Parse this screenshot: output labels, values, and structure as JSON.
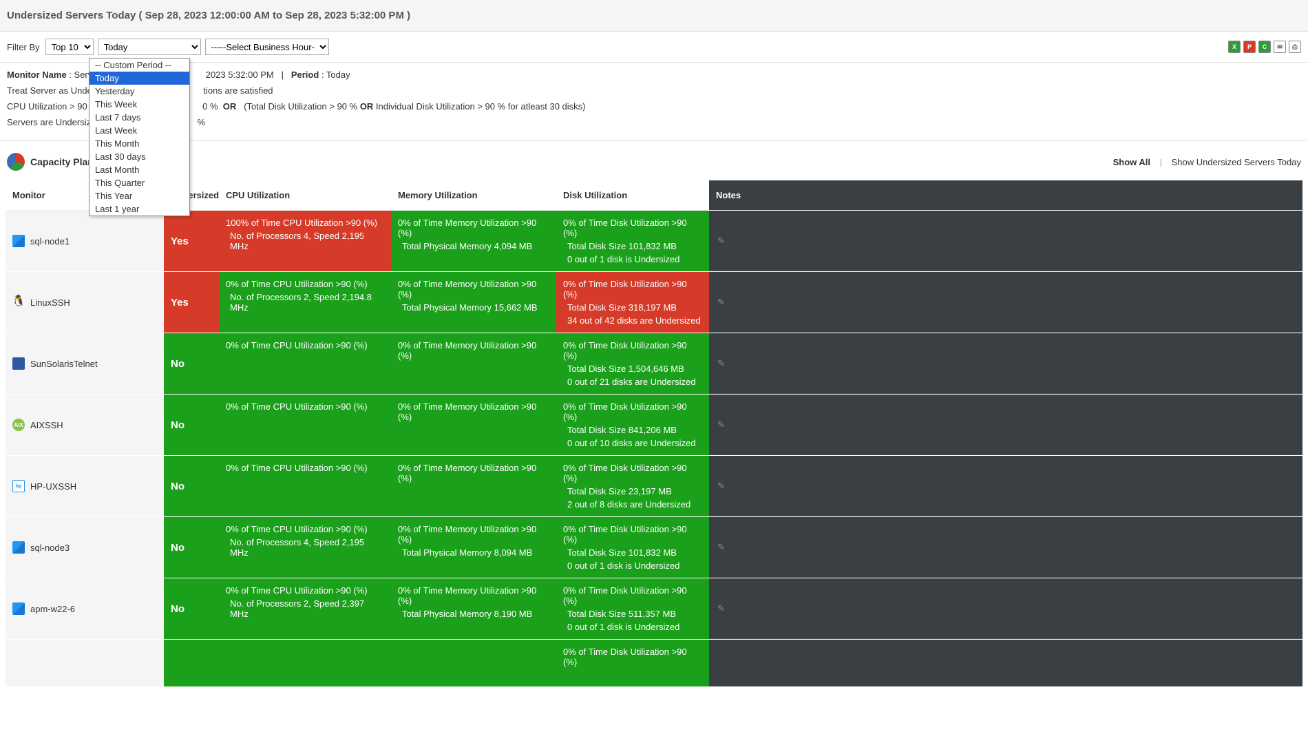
{
  "title": "Undersized Servers Today ( Sep 28, 2023 12:00:00 AM to Sep 28, 2023 5:32:00 PM )",
  "filter": {
    "label": "Filter By",
    "topn": "Top 10",
    "period": "Today",
    "biz_hour": "-----Select Business Hour---"
  },
  "dropdown": {
    "items": [
      "-- Custom Period --",
      "Today",
      "Yesterday",
      "This Week",
      "Last 7 days",
      "Last Week",
      "This Month",
      "Last 30 days",
      "Last Month",
      "This Quarter",
      "This Year",
      "Last 1 year"
    ],
    "selected": "Today"
  },
  "info": {
    "monitor_name_label": "Monitor Name",
    "monitor_name_value": ": Serve",
    "time_suffix": "2023 5:32:00 PM",
    "sep": "|",
    "period_label": "Period",
    "period_value": ": Today",
    "line2_a": "Treat Server as Under",
    "line2_b": "tions are satisfied",
    "line3_a": "CPU Utilization > 90 %",
    "line3_b": "0 %",
    "line3_or": "OR",
    "line3_c": "(Total Disk Utilization > 90 % ",
    "line3_or2": "OR",
    "line3_d": " Individual Disk Utilization > 90 % for atleast 30 disks)",
    "line4_a": "Servers are Undersize",
    "line4_b": "%"
  },
  "section": {
    "title": "Capacity Plan",
    "show_all": "Show All",
    "show_undersized": "Show Undersized Servers Today"
  },
  "columns": {
    "monitor": "Monitor",
    "undersized": "Undersized",
    "cpu": "CPU Utilization",
    "mem": "Memory Utilization",
    "disk": "Disk Utilization",
    "notes": "Notes"
  },
  "rows": [
    {
      "icon": "win",
      "name": "sql-node1",
      "undersized": "Yes",
      "und_color": "red",
      "cpu": {
        "color": "red",
        "l1": "100% of Time CPU Utilization >90 (%)",
        "l2": "No. of Processors 4, Speed 2,195 MHz"
      },
      "mem": {
        "color": "green",
        "l1": "0% of Time Memory Utilization >90 (%)",
        "l2": "Total Physical Memory 4,094 MB"
      },
      "disk": {
        "color": "green",
        "l1": "0% of Time Disk Utilization >90 (%)",
        "l2": "Total Disk Size  101,832 MB",
        "l3": "0 out of 1 disk is Undersized"
      }
    },
    {
      "icon": "lin",
      "name": "LinuxSSH",
      "undersized": "Yes",
      "und_color": "red",
      "cpu": {
        "color": "green",
        "l1": "0% of Time CPU Utilization >90 (%)",
        "l2": "No. of Processors 2, Speed 2,194.8 MHz"
      },
      "mem": {
        "color": "green",
        "l1": "0% of Time Memory Utilization >90 (%)",
        "l2": "Total Physical Memory 15,662 MB"
      },
      "disk": {
        "color": "red",
        "l1": "0% of Time Disk Utilization >90 (%)",
        "l2": "Total Disk Size  318,197 MB",
        "l3": "34 out of 42 disks are Undersized"
      }
    },
    {
      "icon": "sun",
      "name": "SunSolarisTelnet",
      "undersized": "No",
      "und_color": "green",
      "cpu": {
        "color": "green",
        "l1": "0% of Time CPU Utilization >90 (%)"
      },
      "mem": {
        "color": "green",
        "l1": "0% of Time Memory Utilization >90 (%)"
      },
      "disk": {
        "color": "green",
        "l1": "0% of Time Disk Utilization >90 (%)",
        "l2": "Total Disk Size  1,504,646 MB",
        "l3": "0 out of 21 disks are Undersized"
      }
    },
    {
      "icon": "aix",
      "name": "AIXSSH",
      "undersized": "No",
      "und_color": "green",
      "cpu": {
        "color": "green",
        "l1": "0% of Time CPU Utilization >90 (%)"
      },
      "mem": {
        "color": "green",
        "l1": "0% of Time Memory Utilization >90 (%)"
      },
      "disk": {
        "color": "green",
        "l1": "0% of Time Disk Utilization >90 (%)",
        "l2": "Total Disk Size  841,206 MB",
        "l3": "0 out of 10 disks are Undersized"
      }
    },
    {
      "icon": "hp",
      "name": "HP-UXSSH",
      "undersized": "No",
      "und_color": "green",
      "cpu": {
        "color": "green",
        "l1": "0% of Time CPU Utilization >90 (%)"
      },
      "mem": {
        "color": "green",
        "l1": "0% of Time Memory Utilization >90 (%)"
      },
      "disk": {
        "color": "green",
        "l1": "0% of Time Disk Utilization >90 (%)",
        "l2": "Total Disk Size  23,197 MB",
        "l3": "2 out of 8 disks are Undersized"
      }
    },
    {
      "icon": "win",
      "name": "sql-node3",
      "undersized": "No",
      "und_color": "green",
      "cpu": {
        "color": "green",
        "l1": "0% of Time CPU Utilization >90 (%)",
        "l2": "No. of Processors 4, Speed 2,195 MHz"
      },
      "mem": {
        "color": "green",
        "l1": "0% of Time Memory Utilization >90 (%)",
        "l2": "Total Physical Memory 8,094 MB"
      },
      "disk": {
        "color": "green",
        "l1": "0% of Time Disk Utilization >90 (%)",
        "l2": "Total Disk Size  101,832 MB",
        "l3": "0 out of 1 disk is Undersized"
      }
    },
    {
      "icon": "win",
      "name": "apm-w22-6",
      "undersized": "No",
      "und_color": "green",
      "cpu": {
        "color": "green",
        "l1": "0% of Time CPU Utilization >90 (%)",
        "l2": "No. of Processors 2, Speed 2,397 MHz"
      },
      "mem": {
        "color": "green",
        "l1": "0% of Time Memory Utilization >90 (%)",
        "l2": "Total Physical Memory 8,190 MB"
      },
      "disk": {
        "color": "green",
        "l1": "0% of Time Disk Utilization >90 (%)",
        "l2": "Total Disk Size  511,357 MB",
        "l3": "0 out of 1 disk is Undersized"
      }
    },
    {
      "icon": "",
      "name": "",
      "undersized": "",
      "und_color": "green",
      "partial": true,
      "cpu": {
        "color": "green",
        "l1": ""
      },
      "mem": {
        "color": "green",
        "l1": ""
      },
      "disk": {
        "color": "green",
        "l1": "0% of Time Disk Utilization >90 (%)"
      }
    }
  ]
}
